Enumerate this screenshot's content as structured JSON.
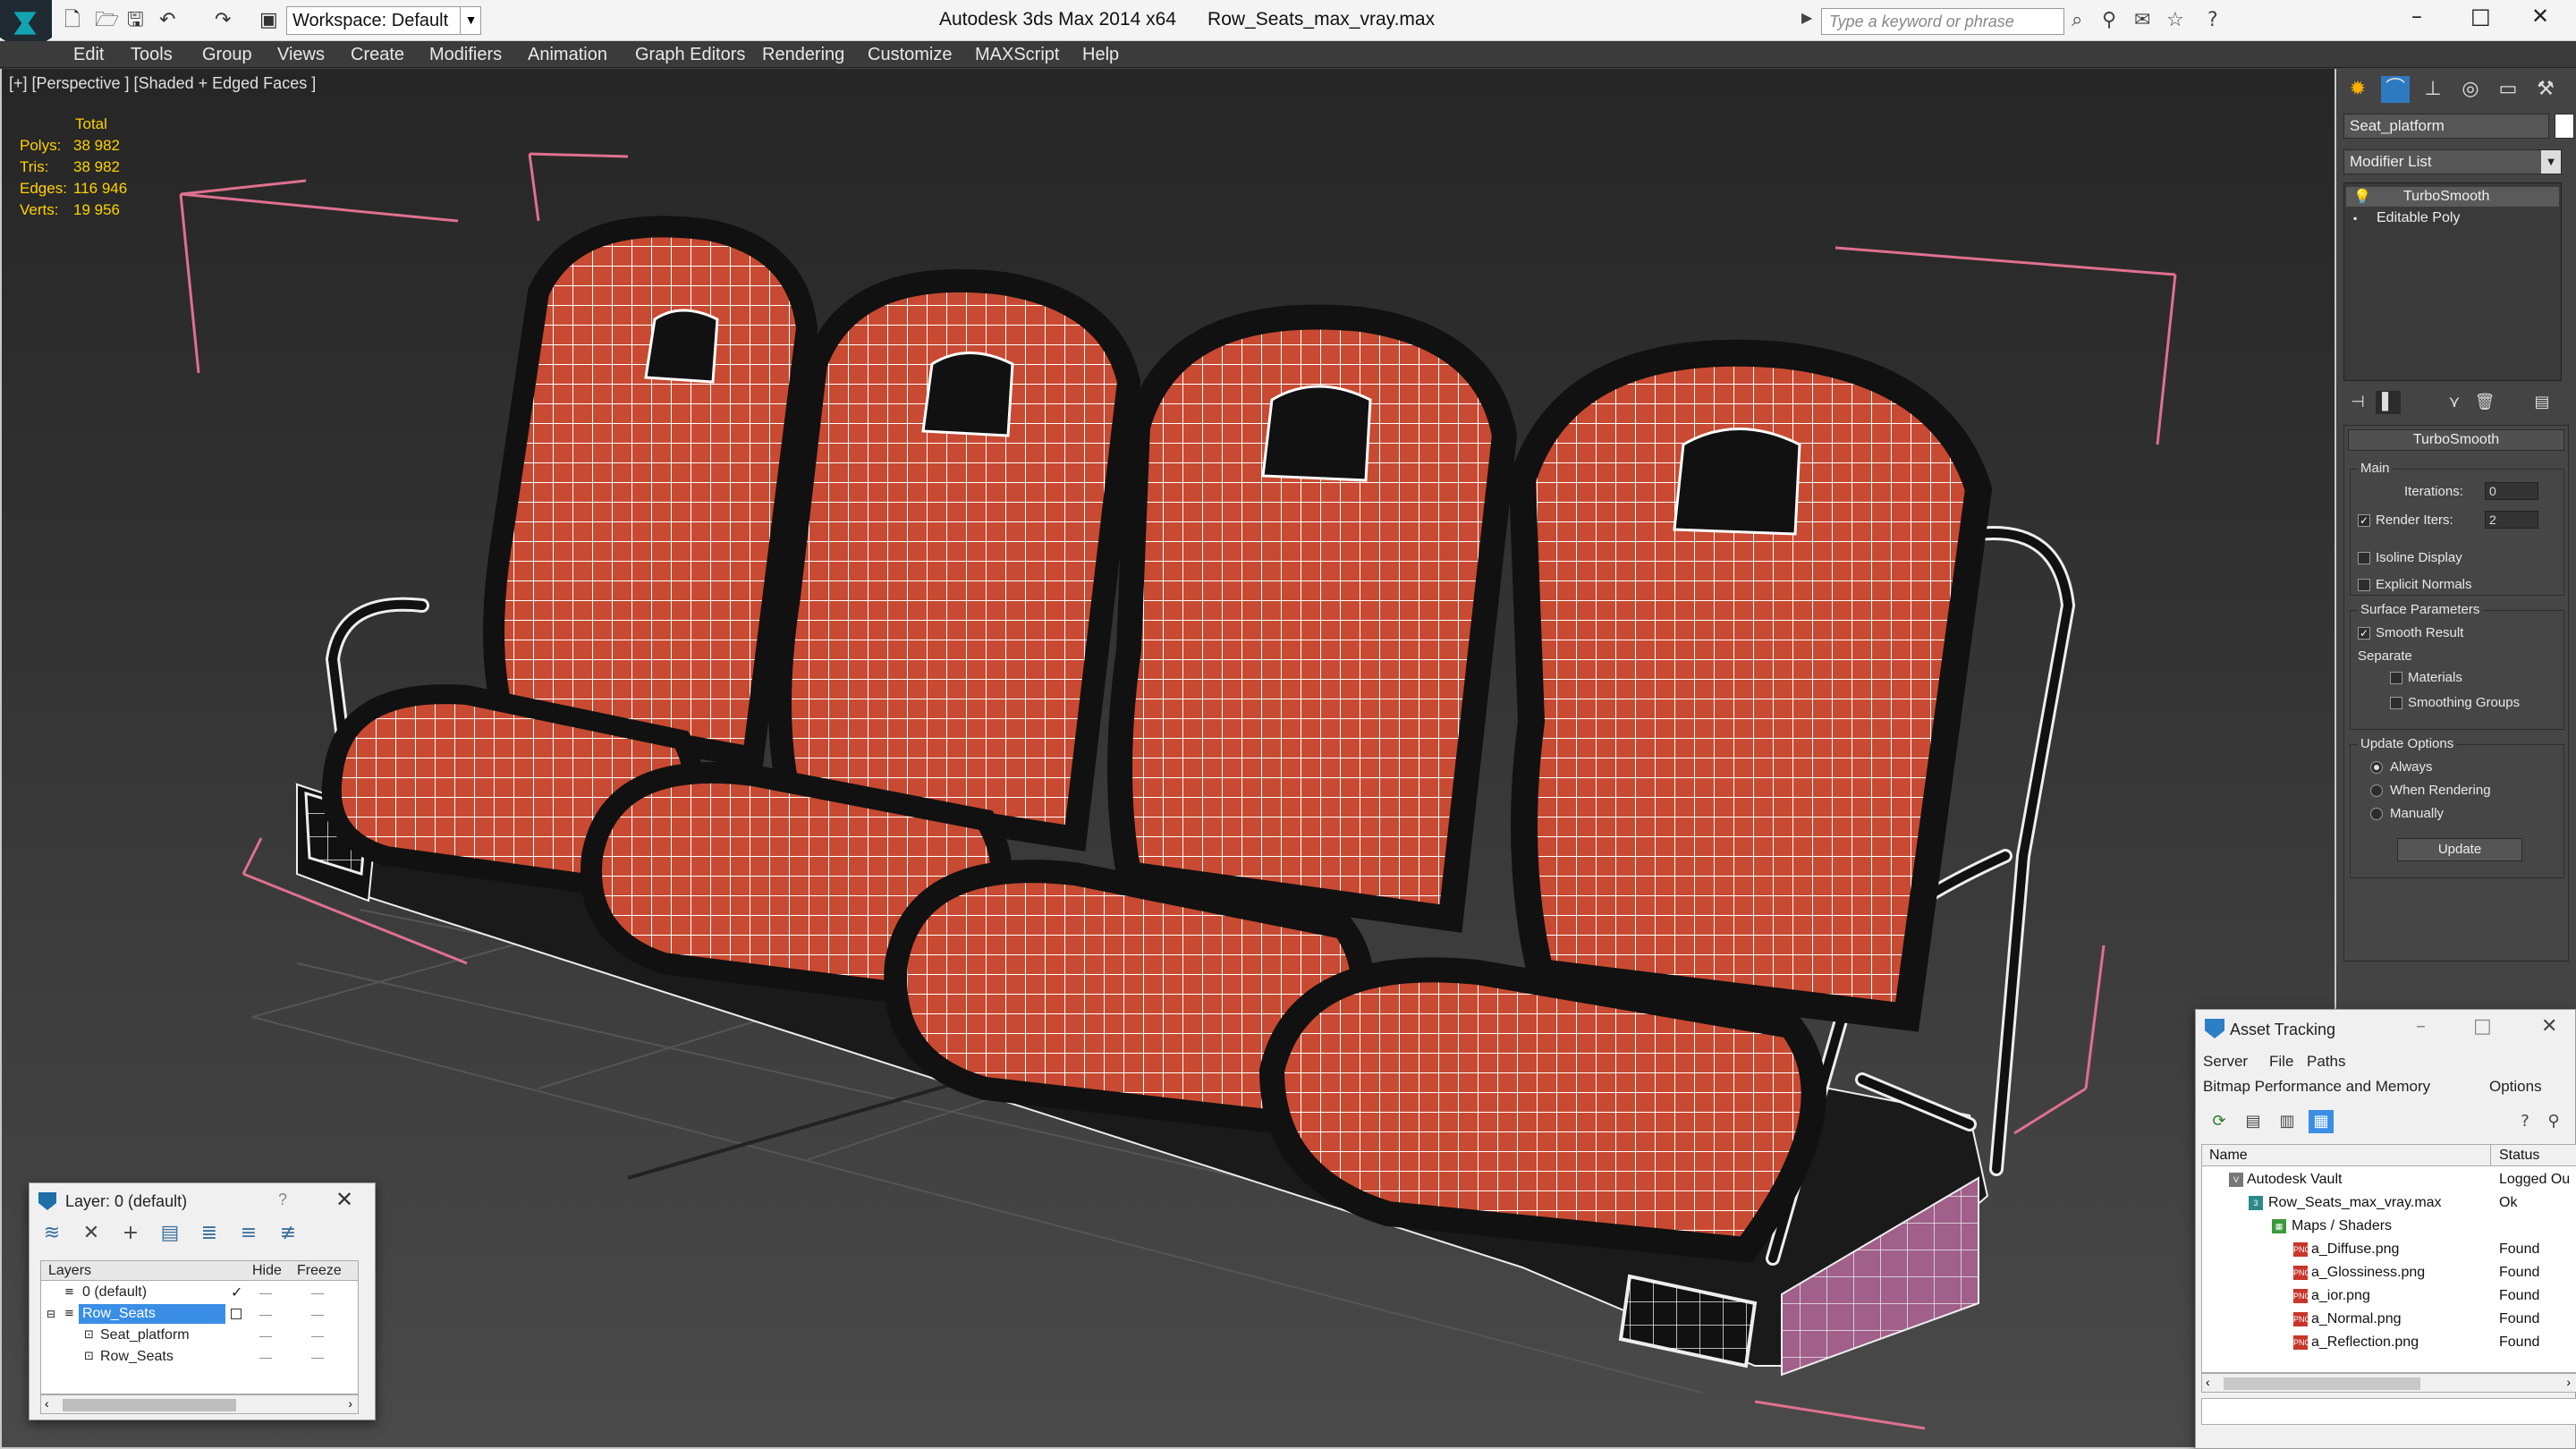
{
  "app": {
    "title": "Autodesk 3ds Max 2014 x64",
    "file": "Row_Seats_max_vray.max",
    "workspace": "Workspace: Default",
    "search_placeholder": "Type a keyword or phrase"
  },
  "menu": [
    "Edit",
    "Tools",
    "Group",
    "Views",
    "Create",
    "Modifiers",
    "Animation",
    "Graph Editors",
    "Rendering",
    "Customize",
    "MAXScript",
    "Help"
  ],
  "viewport": {
    "label": "[+] [Perspective ] [Shaded + Edged Faces ]",
    "stats": {
      "header": "Total",
      "polys_label": "Polys:",
      "polys": "38 982",
      "tris_label": "Tris:",
      "tris": "38 982",
      "edges_label": "Edges:",
      "edges": "116 946",
      "verts_label": "Verts:",
      "verts": "19 956"
    }
  },
  "command_panel": {
    "object_name": "Seat_platform",
    "modifier_list": "Modifier List",
    "stack": [
      "TurboSmooth",
      "Editable Poly"
    ],
    "rollout_title": "TurboSmooth",
    "main_label": "Main",
    "iterations_label": "Iterations:",
    "iterations_value": "0",
    "render_iters_label": "Render Iters:",
    "render_iters_value": "2",
    "isoline_label": "Isoline Display",
    "explicit_normals_label": "Explicit Normals",
    "surface_params_label": "Surface Parameters",
    "smooth_result_label": "Smooth Result",
    "separate_label": "Separate",
    "materials_label": "Materials",
    "smoothing_groups_label": "Smoothing Groups",
    "update_options_label": "Update Options",
    "always_label": "Always",
    "when_rendering_label": "When Rendering",
    "manually_label": "Manually",
    "update_button": "Update"
  },
  "layer_window": {
    "title": "Layer: 0 (default)",
    "help": "?",
    "columns": [
      "Layers",
      "Hide",
      "Freeze"
    ],
    "rows": [
      {
        "name": "0 (default)",
        "indent": 1
      },
      {
        "name": "Row_Seats",
        "indent": 1
      },
      {
        "name": "Seat_platform",
        "indent": 2
      },
      {
        "name": "Row_Seats",
        "indent": 2
      }
    ]
  },
  "asset_window": {
    "title": "Asset Tracking",
    "menu1": [
      "Server",
      "File",
      "Paths"
    ],
    "menu2": [
      "Bitmap Performance and Memory",
      "Options"
    ],
    "columns": [
      "Name",
      "Status"
    ],
    "rows": [
      {
        "name": "Autodesk Vault",
        "status": "Logged Ou",
        "indent": 0
      },
      {
        "name": "Row_Seats_max_vray.max",
        "status": "Ok",
        "indent": 1
      },
      {
        "name": "Maps / Shaders",
        "status": "",
        "indent": 2
      },
      {
        "name": "a_Diffuse.png",
        "status": "Found",
        "indent": 3
      },
      {
        "name": "a_Glossiness.png",
        "status": "Found",
        "indent": 3
      },
      {
        "name": "a_ior.png",
        "status": "Found",
        "indent": 3
      },
      {
        "name": "a_Normal.png",
        "status": "Found",
        "indent": 3
      },
      {
        "name": "a_Reflection.png",
        "status": "Found",
        "indent": 3
      }
    ]
  },
  "colors": {
    "seat_red": "#c84a32",
    "wire": "#ffffff",
    "stats_yellow": "#ffd200",
    "bbox_pink": "#e07090"
  }
}
